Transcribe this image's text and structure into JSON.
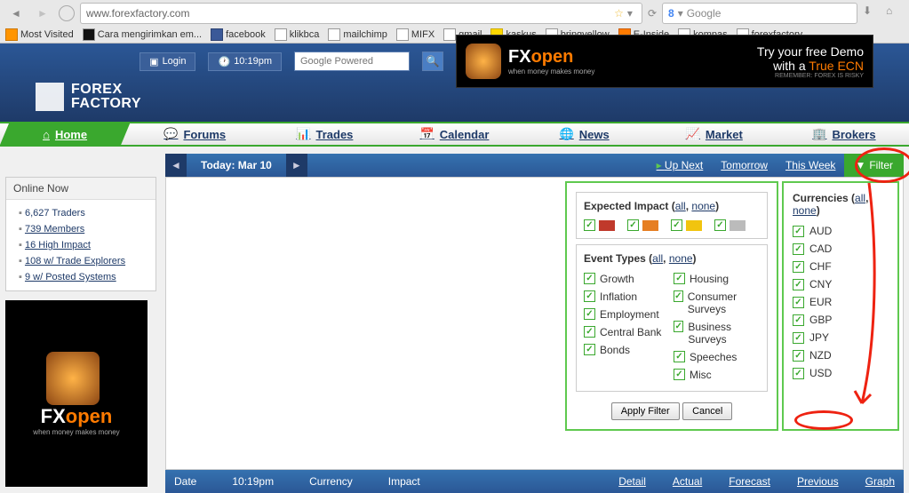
{
  "browser": {
    "url": "www.forexfactory.com",
    "search_placeholder": "Google",
    "bookmarks": [
      "Most Visited",
      "Cara mengirimkan em...",
      "facebook",
      "klikbca",
      "mailchimp",
      "MIFX",
      "gmail",
      "kaskus",
      "bringyellow",
      "E-Inside",
      "kompas",
      "forexfactory"
    ]
  },
  "header": {
    "login": "Login",
    "time": "10:19pm",
    "search_placeholder": "Google Powered",
    "logo_line1": "FOREX",
    "logo_line2": "FACTORY",
    "ad_fx": "FX",
    "ad_open": "open",
    "ad_tag": "when money makes money",
    "ad_line1": "Try your free Demo",
    "ad_line2a": "with a  ",
    "ad_line2b": "True ECN",
    "ad_foot": "REMEMBER: FOREX IS RISKY"
  },
  "nav": {
    "home": "Home",
    "forums": "Forums",
    "trades": "Trades",
    "calendar": "Calendar",
    "news": "News",
    "market": "Market",
    "brokers": "Brokers"
  },
  "sidebar": {
    "online_title": "Online Now",
    "items": [
      "6,627 Traders",
      "739 Members",
      "16 High Impact",
      "108 w/ Trade Explorers",
      "9 w/ Posted Systems"
    ],
    "ad_fx": "FX",
    "ad_open": "open",
    "ad_tag": "when money  makes money"
  },
  "datebar": {
    "today": "Today: Mar 10",
    "upnext": "Up Next",
    "tomorrow": "Tomorrow",
    "thisweek": "This Week",
    "filter": "Filter"
  },
  "filter": {
    "impact_title": "Expected Impact",
    "all": "all",
    "none": "none",
    "event_title": "Event Types",
    "event_left": [
      "Growth",
      "Inflation",
      "Employment",
      "Central Bank",
      "Bonds"
    ],
    "event_right": [
      "Housing",
      "Consumer Surveys",
      "Business Surveys",
      "Speeches",
      "Misc"
    ],
    "curr_title": "Currencies",
    "currencies": [
      "AUD",
      "CAD",
      "CHF",
      "CNY",
      "EUR",
      "GBP",
      "JPY",
      "NZD",
      "USD"
    ],
    "apply": "Apply Filter",
    "cancel": "Cancel"
  },
  "bottombar": {
    "left": [
      "Date",
      "10:19pm",
      "Currency",
      "Impact"
    ],
    "right": [
      "Detail",
      "Actual",
      "Forecast",
      "Previous",
      "Graph"
    ]
  }
}
